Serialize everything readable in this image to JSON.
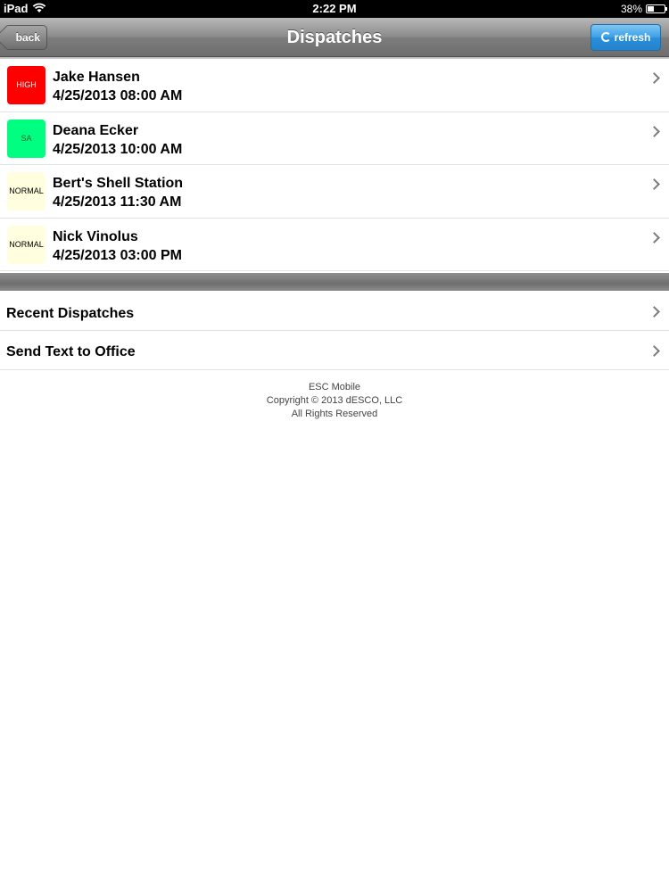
{
  "status_bar": {
    "device": "iPad",
    "time": "2:22 PM",
    "battery_percent": "38%",
    "battery_level": 0.38
  },
  "nav": {
    "title": "Dispatches",
    "back_label": "back",
    "refresh_label": "refresh",
    "refresh_color": "#3a9fe3"
  },
  "dispatches": [
    {
      "badge": "HIGH",
      "badge_color": "#ff0000",
      "badge_text_color": "#ffffff",
      "name": "Jake Hansen",
      "datetime": "4/25/2013 08:00 AM"
    },
    {
      "badge": "SA",
      "badge_color": "#00ff80",
      "badge_text_color": "#006633",
      "name": "Deana Ecker",
      "datetime": "4/25/2013 10:00 AM"
    },
    {
      "badge": "NORMAL",
      "badge_color": "#ffffe0",
      "badge_text_color": "#000000",
      "name": "Bert's Shell Station",
      "datetime": "4/25/2013 11:30 AM"
    },
    {
      "badge": "NORMAL",
      "badge_color": "#ffffe0",
      "badge_text_color": "#000000",
      "name": "Nick Vinolus",
      "datetime": "4/25/2013 03:00 PM"
    }
  ],
  "menu": [
    {
      "label": "Recent Dispatches"
    },
    {
      "label": "Send Text to Office"
    }
  ],
  "footer": {
    "app_name": "ESC Mobile",
    "copyright": "Copyright © 2013 dESCO, LLC",
    "rights": "All Rights Reserved"
  }
}
